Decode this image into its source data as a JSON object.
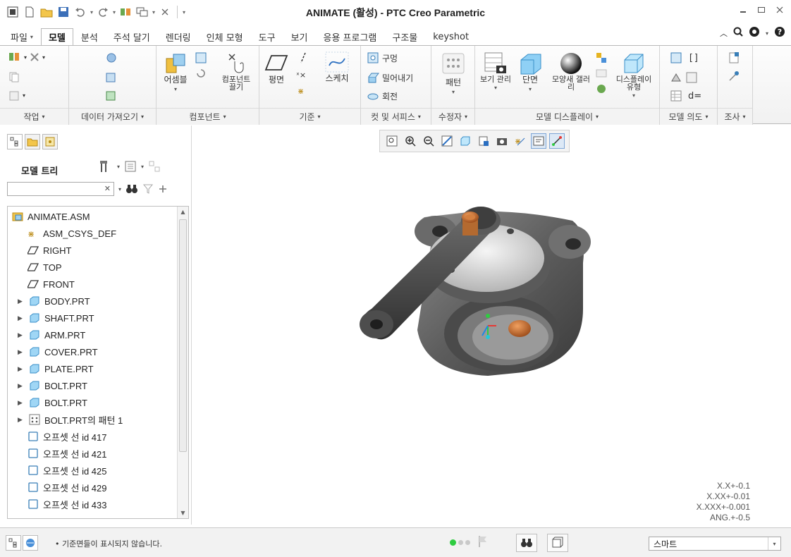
{
  "window": {
    "title": "ANIMATE (활성) - PTC Creo Parametric"
  },
  "tabs": [
    {
      "label": "파일",
      "has_caret": true
    },
    {
      "label": "모델",
      "active": true
    },
    {
      "label": "분석"
    },
    {
      "label": "주석 달기"
    },
    {
      "label": "렌더링"
    },
    {
      "label": "인체 모형"
    },
    {
      "label": "도구"
    },
    {
      "label": "보기"
    },
    {
      "label": "응용 프로그램"
    },
    {
      "label": "구조물"
    },
    {
      "label": "keyshot"
    }
  ],
  "ribbon": {
    "groups": {
      "operations": "작업",
      "get_data": "데이터 가져오기",
      "component": "컴포넌트",
      "datum": "기준",
      "cut_surface": "컷 및 서피스",
      "modifiers": "수정자",
      "model_display": "모델 디스플레이",
      "model_intent": "모델 의도",
      "investigate": "조사"
    },
    "buttons": {
      "assemble": "어셈블",
      "drag_components": "컴포넌트 끌기",
      "plane": "평면",
      "sketch": "스케치",
      "hole": "구멍",
      "extrude": "밀어내기",
      "revolve": "회전",
      "pattern": "패턴",
      "view_manager": "보기 관리",
      "section": "단면",
      "appearance_gallery": "모양새 갤러리",
      "display_style": "디스플레이 유형",
      "relations": "d="
    }
  },
  "panel": {
    "title": "모델 트리",
    "search_value": "",
    "items": [
      {
        "label": "ANIMATE.ASM",
        "icon": "assembly-icon",
        "expandable": false,
        "level": 0
      },
      {
        "label": "ASM_CSYS_DEF",
        "icon": "csys-icon",
        "expandable": false,
        "level": 1
      },
      {
        "label": "RIGHT",
        "icon": "datum-plane-icon",
        "expandable": false,
        "level": 1
      },
      {
        "label": "TOP",
        "icon": "datum-plane-icon",
        "expandable": false,
        "level": 1
      },
      {
        "label": "FRONT",
        "icon": "datum-plane-icon",
        "expandable": false,
        "level": 1
      },
      {
        "label": "BODY.PRT",
        "icon": "part-icon",
        "expandable": true,
        "level": 0
      },
      {
        "label": "SHAFT.PRT",
        "icon": "part-icon",
        "expandable": true,
        "level": 0
      },
      {
        "label": "ARM.PRT",
        "icon": "part-icon",
        "expandable": true,
        "level": 0
      },
      {
        "label": "COVER.PRT",
        "icon": "part-icon",
        "expandable": true,
        "level": 0
      },
      {
        "label": "PLATE.PRT",
        "icon": "part-icon",
        "expandable": true,
        "level": 0
      },
      {
        "label": "BOLT.PRT",
        "icon": "part-icon",
        "expandable": true,
        "level": 0
      },
      {
        "label": "BOLT.PRT",
        "icon": "part-icon",
        "expandable": true,
        "level": 0
      },
      {
        "label": "BOLT.PRT의 패턴 1",
        "icon": "pattern-icon",
        "expandable": true,
        "level": 0
      },
      {
        "label": "오프셋 선 id 417",
        "icon": "offset-line-icon",
        "expandable": false,
        "level": 1
      },
      {
        "label": "오프셋 선 id 421",
        "icon": "offset-line-icon",
        "expandable": false,
        "level": 1
      },
      {
        "label": "오프셋 선 id 425",
        "icon": "offset-line-icon",
        "expandable": false,
        "level": 1
      },
      {
        "label": "오프셋 선 id 429",
        "icon": "offset-line-icon",
        "expandable": false,
        "level": 1
      },
      {
        "label": "오프셋 선 id 433",
        "icon": "offset-line-icon",
        "expandable": false,
        "level": 1
      }
    ]
  },
  "graphics": {
    "tolerances": [
      "X.X+-0.1",
      "X.XX+-0.01",
      "X.XXX+-0.001",
      "ANG.+-0.5"
    ]
  },
  "status": {
    "message": "• 기준면들이 표시되지 않습니다.",
    "filter_value": "스마트"
  },
  "colors": {
    "accent": "#2b6fc1",
    "part_icon": "#57b3e3",
    "status_green": "#2ecc40"
  }
}
